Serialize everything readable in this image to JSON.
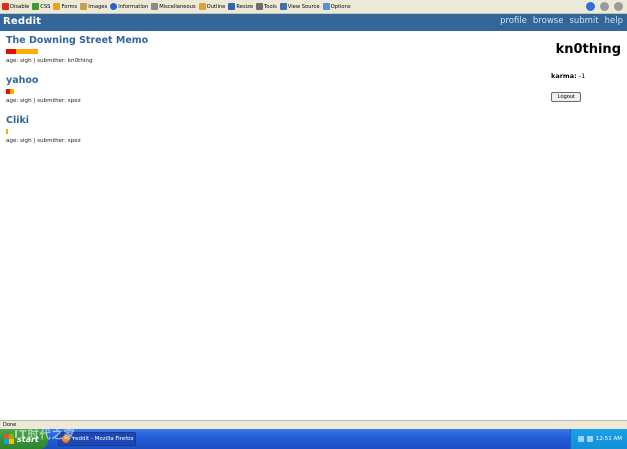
{
  "browser_toolbar": {
    "items": [
      {
        "label": "Disable",
        "icon": "disable-icon",
        "color": "#d82c1c"
      },
      {
        "label": "CSS",
        "icon": "css-icon",
        "color": "#3e9c2e"
      },
      {
        "label": "Forms",
        "icon": "forms-icon",
        "color": "#e0a526"
      },
      {
        "label": "Images",
        "icon": "images-icon",
        "color": "#c7a050"
      },
      {
        "label": "Information",
        "icon": "information-icon",
        "color": "#2a61c9"
      },
      {
        "label": "Miscellaneous",
        "icon": "miscellaneous-icon",
        "color": "#8a8a8a"
      },
      {
        "label": "Outline",
        "icon": "outline-icon",
        "color": "#d9a43a"
      },
      {
        "label": "Resize",
        "icon": "resize-icon",
        "color": "#2e64b8"
      },
      {
        "label": "Tools",
        "icon": "tools-icon",
        "color": "#6e6e6e"
      },
      {
        "label": "View Source",
        "icon": "view-source-icon",
        "color": "#3f6fb5"
      },
      {
        "label": "Options",
        "icon": "options-icon",
        "color": "#5e8ed2"
      }
    ]
  },
  "header": {
    "logo": "Reddit",
    "nav": [
      "profile",
      "browse",
      "submit",
      "help"
    ]
  },
  "stories": [
    {
      "title": "The Downing Street Memo",
      "meta": "age: sigh | submitter: kn0thing",
      "bar": [
        {
          "value": 3,
          "color": "#dd1100"
        },
        {
          "value": 5,
          "color": "#ffaa00"
        }
      ]
    },
    {
      "title": "yahoo",
      "meta": "age: sigh | submitter: spez",
      "bar": [
        {
          "value": 1,
          "color": "#dd1100"
        },
        {
          "value": 1,
          "color": "#ffaa00"
        }
      ]
    },
    {
      "title": "Cliki",
      "meta": "age: sigh | submitter: spez",
      "bar": [
        {
          "value": 0,
          "color": "#dd1100"
        },
        {
          "value": 0.5,
          "color": "#ffaa00"
        }
      ]
    }
  ],
  "sidebar": {
    "username": "kn0thing",
    "karma_label": "karma:",
    "karma_value": "-1",
    "logout_label": "Logout"
  },
  "status_bar": {
    "text": "Done"
  },
  "taskbar": {
    "start_label": "start",
    "task_label": "reddit - Mozilla Firefox",
    "clock": "12:51 AM",
    "watermark": "IT时代之家"
  },
  "colors": {
    "accent": "#336699",
    "bar_red": "#dd1100",
    "bar_orange": "#ffaa00"
  }
}
